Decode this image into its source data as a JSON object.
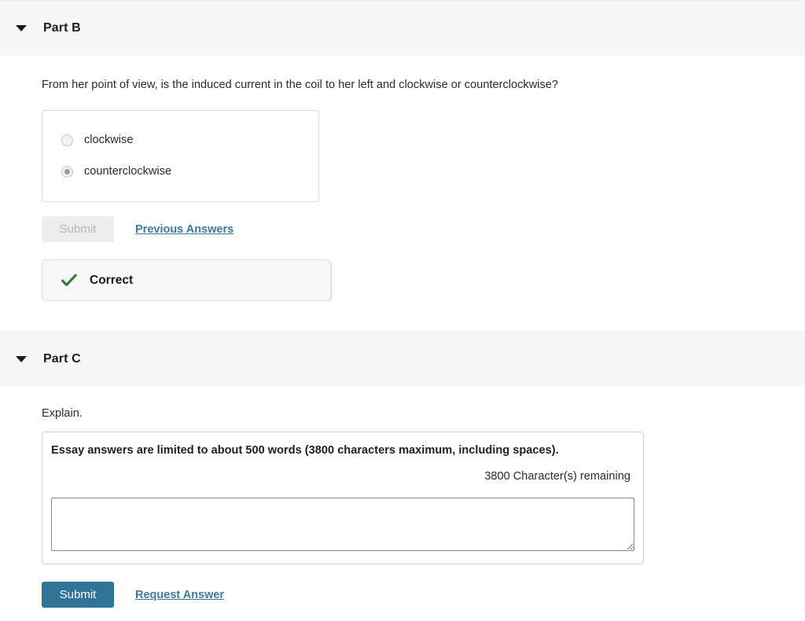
{
  "theme": {
    "header_bg": "#f7f7f7",
    "page_bg": "#ffffff",
    "link_color": "#3a7a9e",
    "primary_button_color": "#2f7396",
    "disabled_button_bg": "#ededed",
    "disabled_button_text": "#b5b5b5",
    "correct_check_color": "#2d7a35",
    "result_box_bg": "#f8f8f8"
  },
  "parts": [
    {
      "id": "part-b",
      "header": {
        "title": "Part B",
        "disclosure_icon": "triangle-down-icon",
        "expanded": true
      },
      "question": "From her point of view, is the induced current in the coil to her left and clockwise or counterclockwise?",
      "choices": {
        "type": "radio",
        "disabled": true,
        "options": [
          {
            "label": "clockwise",
            "selected": false
          },
          {
            "label": "counterclockwise",
            "selected": true
          }
        ]
      },
      "actions": {
        "submit_label": "Submit",
        "submit_disabled": true,
        "link_label": "Previous Answers"
      },
      "result": {
        "icon": "checkmark-icon",
        "label": "Correct"
      }
    },
    {
      "id": "part-c",
      "header": {
        "title": "Part C",
        "disclosure_icon": "triangle-down-icon",
        "expanded": true
      },
      "prompt": "Explain.",
      "essay": {
        "notice": "Essay answers are limited to about 500 words (3800 characters maximum, including spaces).",
        "remaining": "3800 Character(s) remaining",
        "value": "",
        "placeholder": ""
      },
      "actions": {
        "submit_label": "Submit",
        "submit_disabled": false,
        "link_label": "Request Answer"
      }
    }
  ]
}
